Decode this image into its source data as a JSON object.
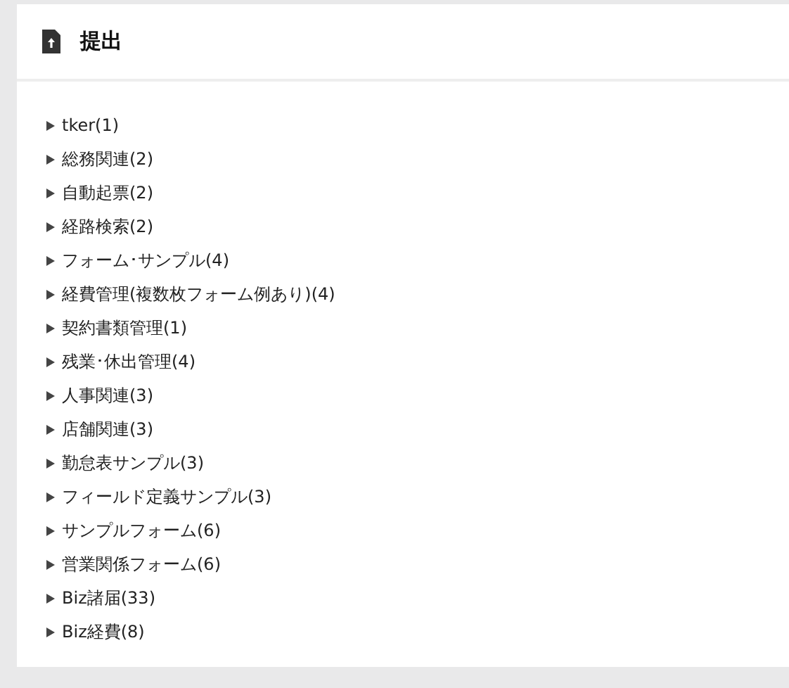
{
  "panel": {
    "title": "提出"
  },
  "categories": [
    {
      "label": "tker(1)",
      "expanded": false
    },
    {
      "label": "総務関連(2)",
      "expanded": false
    },
    {
      "label": "自動起票(2)",
      "expanded": false
    },
    {
      "label": "経路検索(2)",
      "expanded": false
    },
    {
      "label": "フォーム･サンプル(4)",
      "expanded": false
    },
    {
      "label": "経費管理(複数枚フォーム例あり)(4)",
      "expanded": false
    },
    {
      "label": "契約書類管理(1)",
      "expanded": false
    },
    {
      "label": "残業･休出管理(4)",
      "expanded": false
    },
    {
      "label": "人事関連(3)",
      "expanded": false
    },
    {
      "label": "店舗関連(3)",
      "expanded": false
    },
    {
      "label": "勤怠表サンプル(3)",
      "expanded": false
    },
    {
      "label": "フィールド定義サンプル(3)",
      "expanded": false
    },
    {
      "label": "サンプルフォーム(6)",
      "expanded": false
    },
    {
      "label": "営業関係フォーム(6)",
      "expanded": false
    },
    {
      "label": "Biz諸届(33)",
      "expanded": false
    },
    {
      "label": "Biz経費(8)",
      "expanded": false
    }
  ]
}
